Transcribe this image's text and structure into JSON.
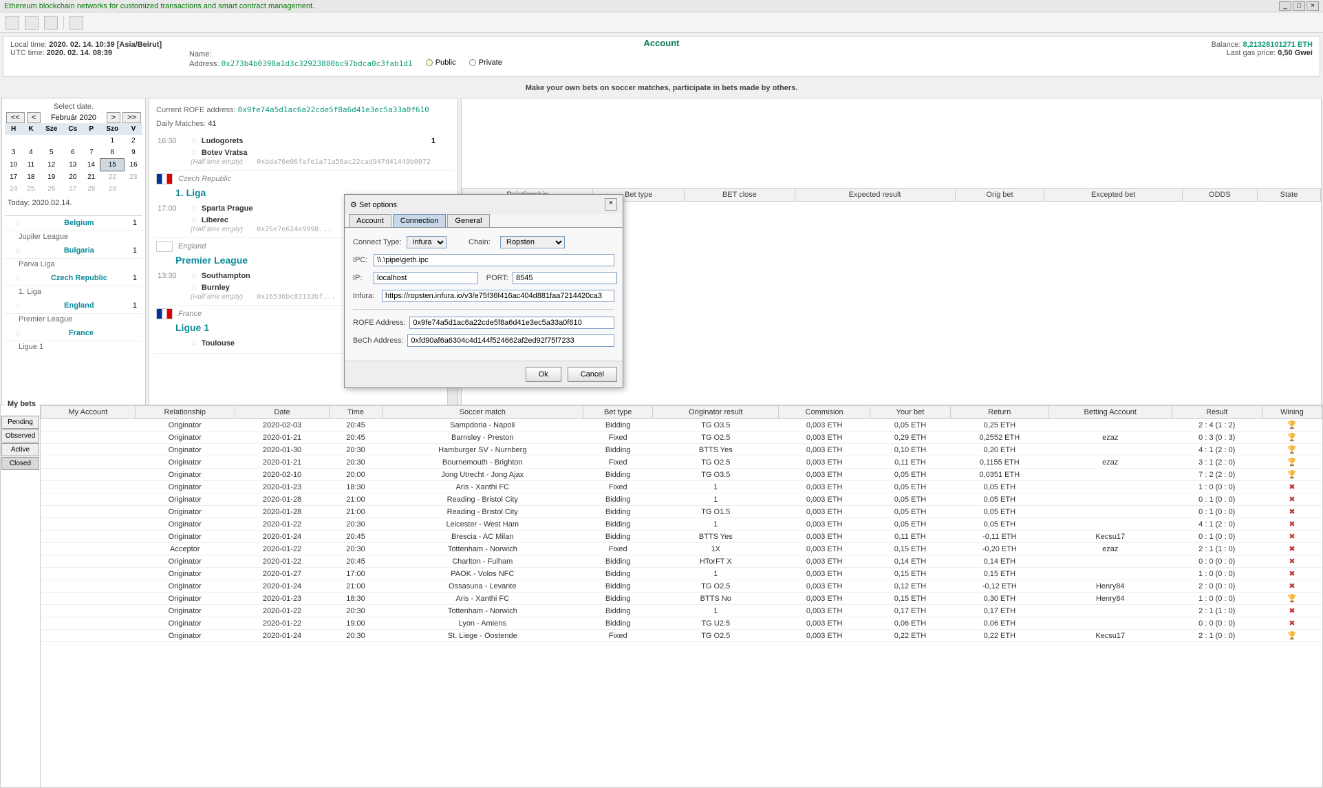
{
  "app": {
    "title": "Ethereum blockchain networks for customized transactions and smart contract management."
  },
  "time": {
    "local_label": "Local time:",
    "local_value": "2020. 02. 14. 10:39 [Asia/Beirut]",
    "utc_label": "UTC time:",
    "utc_value": "2020. 02. 14. 08:39"
  },
  "account": {
    "title": "Account",
    "name_label": "Name:",
    "address_label": "Address:",
    "address_value": "0x273b4b0398a1d3c32923880bc97bdca0c3fab1d1",
    "public_label": "Public",
    "private_label": "Private",
    "balance_label": "Balance:",
    "balance_value": "8,21328101271 ETH",
    "gas_label": "Last gas price:",
    "gas_value": "0,50 Gwei"
  },
  "subtitle": "Make your own bets on soccer matches, participate in bets made by others.",
  "calendar": {
    "select_label": "Select date.",
    "month": "Február",
    "year": "2020",
    "days": [
      "H",
      "K",
      "Sze",
      "Cs",
      "P",
      "Szo",
      "V"
    ],
    "today_label": "Today:",
    "today_value": "2020.02.14."
  },
  "countries": [
    {
      "name": "Belgium",
      "count": "1",
      "league": "Jupiler League"
    },
    {
      "name": "Bulgaria",
      "count": "1",
      "league": "Parva Liga"
    },
    {
      "name": "Czech Republic",
      "count": "1",
      "league": "1. Liga"
    },
    {
      "name": "England",
      "count": "1",
      "league": "Premier League"
    },
    {
      "name": "France",
      "count": "",
      "league": "Ligue 1"
    }
  ],
  "matches": {
    "rofe_label": "Current ROFE address:",
    "rofe_value": "0x9fe74a5d1ac6a22cde5f8a6d41e3ec5a33a0f610",
    "daily_label": "Daily Matches:",
    "daily_value": "41",
    "groups": [
      {
        "time": "16:30",
        "team1": "Ludogorets",
        "team2": "Botev Vratsa",
        "score": "1",
        "halftime": "(Half time empty)",
        "hash": "0xbda76e06fafe1a71a56ac22cad947d41449b0072"
      },
      {
        "country": "Czech Republic",
        "flag": "cz",
        "league": "1. Liga",
        "time": "17:00",
        "team1": "Sparta Prague",
        "team2": "Liberec",
        "halftime": "(Half time empty)",
        "hash": "0x25e7e624e9998..."
      },
      {
        "country": "England",
        "flag": "en",
        "league": "Premier League",
        "time": "13:30",
        "team1": "Southampton",
        "team2": "Burnley",
        "halftime": "(Half time empty)",
        "hash": "0x16536bc83133bf..."
      },
      {
        "country": "France",
        "flag": "fr",
        "league": "Ligue 1",
        "time": "",
        "team1": "Toulouse",
        "team2": "",
        "halftime": "",
        "hash": ""
      }
    ]
  },
  "bet_headers": [
    "Relationship",
    "Bet type",
    "BET close",
    "Expected result",
    "Orig bet",
    "Excepted bet",
    "ODDS",
    "State"
  ],
  "modal": {
    "title": "Set options",
    "tabs": [
      "Account",
      "Connection",
      "General"
    ],
    "connect_type_label": "Connect Type:",
    "connect_type_value": "infura",
    "chain_label": "Chain:",
    "chain_value": "Ropsten",
    "ipc_label": "IPC:",
    "ipc_value": "\\\\.\\pipe\\geth.ipc",
    "ip_label": "IP:",
    "ip_value": "localhost",
    "port_label": "PORT:",
    "port_value": "8545",
    "infura_label": "Infura:",
    "infura_value": "https://ropsten.infura.io/v3/e75f36f416ac404d881faa7214420ca3",
    "rofe_label": "ROFE Address:",
    "rofe_value": "0x9fe74a5d1ac6a22cde5f8a6d41e3ec5a33a0f610",
    "bech_label": "BeCh Address:",
    "bech_value": "0xfd90af6a6304c4d144f524662af2ed92f75f7233",
    "ok": "Ok",
    "cancel": "Cancel"
  },
  "mybets": {
    "title": "My bets",
    "status_tabs": [
      "Pending",
      "Observed",
      "Active",
      "Closed"
    ],
    "headers": [
      "My Account",
      "Relationship",
      "Date",
      "Time",
      "Soccer match",
      "Bet type",
      "Originator result",
      "Commision",
      "Your bet",
      "Return",
      "Betting Account",
      "Result",
      "Wining"
    ],
    "rows": [
      {
        "rel": "Originator",
        "date": "2020-02-03",
        "time": "20:45",
        "match": "Sampdoria - Napoli",
        "btype": "Bidding",
        "ores": "TG O3.5",
        "com": "0,003 ETH",
        "ybet": "0,05 ETH",
        "ret": "0,25 ETH",
        "retc": "pos",
        "bacc": "",
        "result": "2 : 4 (1 : 2)",
        "win": "y"
      },
      {
        "rel": "Originator",
        "date": "2020-01-21",
        "time": "20:45",
        "match": "Barnsley - Preston",
        "btype": "Fixed",
        "ores": "TG O2.5",
        "com": "0,003 ETH",
        "ybet": "0,29 ETH",
        "ret": "0,2552 ETH",
        "retc": "pos",
        "bacc": "ezaz",
        "result": "0 : 3 (0 : 3)",
        "win": "y"
      },
      {
        "rel": "Originator",
        "date": "2020-01-30",
        "time": "20:30",
        "match": "Hamburger SV - Nurnberg",
        "btype": "Bidding",
        "ores": "BTTS Yes",
        "com": "0,003 ETH",
        "ybet": "0,10 ETH",
        "ret": "0,20 ETH",
        "retc": "pos",
        "bacc": "",
        "result": "4 : 1 (2 : 0)",
        "win": "y"
      },
      {
        "rel": "Originator",
        "date": "2020-01-21",
        "time": "20:30",
        "match": "Bournemouth - Brighton",
        "btype": "Fixed",
        "ores": "TG O2.5",
        "com": "0,003 ETH",
        "ybet": "0,11 ETH",
        "ret": "0,1155 ETH",
        "retc": "pos",
        "bacc": "ezaz",
        "result": "3 : 1 (2 : 0)",
        "win": "y"
      },
      {
        "rel": "Originator",
        "date": "2020-02-10",
        "time": "20:00",
        "match": "Jong Utrecht - Jong Ajax",
        "btype": "Bidding",
        "ores": "TG O3.5",
        "com": "0,003 ETH",
        "ybet": "0,05 ETH",
        "ret": "0,0351 ETH",
        "retc": "pos",
        "bacc": "",
        "result": "7 : 2 (2 : 0)",
        "win": "y"
      },
      {
        "rel": "Originator",
        "date": "2020-01-23",
        "time": "18:30",
        "match": "Aris - Xanthi FC",
        "btype": "Fixed",
        "ores": "1",
        "com": "0,003 ETH",
        "ybet": "0,05 ETH",
        "ret": "0,05 ETH",
        "retc": "gray",
        "bacc": "",
        "result": "1 : 0 (0 : 0)",
        "win": "n"
      },
      {
        "rel": "Originator",
        "date": "2020-01-28",
        "time": "21:00",
        "match": "Reading - Bristol City",
        "btype": "Bidding",
        "ores": "1",
        "com": "0,003 ETH",
        "ybet": "0,05 ETH",
        "ret": "0,05 ETH",
        "retc": "gray",
        "bacc": "",
        "result": "0 : 1 (0 : 0)",
        "win": "n"
      },
      {
        "rel": "Originator",
        "date": "2020-01-28",
        "time": "21:00",
        "match": "Reading - Bristol City",
        "btype": "Bidding",
        "ores": "TG O1.5",
        "com": "0,003 ETH",
        "ybet": "0,05 ETH",
        "ret": "0,05 ETH",
        "retc": "gray",
        "bacc": "",
        "result": "0 : 1 (0 : 0)",
        "win": "n"
      },
      {
        "rel": "Originator",
        "date": "2020-01-22",
        "time": "20:30",
        "match": "Leicester - West Ham",
        "btype": "Bidding",
        "ores": "1",
        "com": "0,003 ETH",
        "ybet": "0,05 ETH",
        "ret": "0,05 ETH",
        "retc": "gray",
        "bacc": "",
        "result": "4 : 1 (2 : 0)",
        "win": "n"
      },
      {
        "rel": "Originator",
        "date": "2020-01-24",
        "time": "20:45",
        "match": "Brescia - AC Milan",
        "btype": "Bidding",
        "ores": "BTTS Yes",
        "com": "0,003 ETH",
        "ybet": "0,11 ETH",
        "ret": "-0,11 ETH",
        "retc": "neg",
        "bacc": "Kecsu17",
        "result": "0 : 1 (0 : 0)",
        "win": "n"
      },
      {
        "rel": "Acceptor",
        "date": "2020-01-22",
        "time": "20:30",
        "match": "Tottenham - Norwich",
        "btype": "Fixed",
        "ores": "1X",
        "com": "0,003 ETH",
        "ybet": "0,15 ETH",
        "ret": "-0,20 ETH",
        "retc": "neg",
        "bacc": "ezaz",
        "result": "2 : 1 (1 : 0)",
        "win": "n"
      },
      {
        "rel": "Originator",
        "date": "2020-01-22",
        "time": "20:45",
        "match": "Charlton - Fulham",
        "btype": "Bidding",
        "ores": "HTorFT X",
        "com": "0,003 ETH",
        "ybet": "0,14 ETH",
        "ret": "0,14 ETH",
        "retc": "gray",
        "bacc": "",
        "result": "0 : 0 (0 : 0)",
        "win": "n"
      },
      {
        "rel": "Originator",
        "date": "2020-01-27",
        "time": "17:00",
        "match": "PAOK - Volos NFC",
        "btype": "Bidding",
        "ores": "1",
        "com": "0,003 ETH",
        "ybet": "0,15 ETH",
        "ret": "0,15 ETH",
        "retc": "gray",
        "bacc": "",
        "result": "1 : 0 (0 : 0)",
        "win": "n"
      },
      {
        "rel": "Originator",
        "date": "2020-01-24",
        "time": "21:00",
        "match": "Ossasuna - Levante",
        "btype": "Bidding",
        "ores": "TG O2.5",
        "com": "0,003 ETH",
        "ybet": "0,12 ETH",
        "ret": "-0,12 ETH",
        "retc": "neg",
        "bacc": "Henry84",
        "result": "2 : 0 (0 : 0)",
        "win": "n"
      },
      {
        "rel": "Originator",
        "date": "2020-01-23",
        "time": "18:30",
        "match": "Aris - Xanthi FC",
        "btype": "Bidding",
        "ores": "BTTS No",
        "com": "0,003 ETH",
        "ybet": "0,15 ETH",
        "ret": "0,30 ETH",
        "retc": "pos",
        "bacc": "Henry84",
        "result": "1 : 0 (0 : 0)",
        "win": "y"
      },
      {
        "rel": "Originator",
        "date": "2020-01-22",
        "time": "20:30",
        "match": "Tottenham - Norwich",
        "btype": "Bidding",
        "ores": "1",
        "com": "0,003 ETH",
        "ybet": "0,17 ETH",
        "ret": "0,17 ETH",
        "retc": "gray",
        "bacc": "",
        "result": "2 : 1 (1 : 0)",
        "win": "n"
      },
      {
        "rel": "Originator",
        "date": "2020-01-22",
        "time": "19:00",
        "match": "Lyon - Amiens",
        "btype": "Bidding",
        "ores": "TG U2.5",
        "com": "0,003 ETH",
        "ybet": "0,06 ETH",
        "ret": "0,06 ETH",
        "retc": "gray",
        "bacc": "",
        "result": "0 : 0 (0 : 0)",
        "win": "n"
      },
      {
        "rel": "Originator",
        "date": "2020-01-24",
        "time": "20:30",
        "match": "St. Liege - Oostende",
        "btype": "Fixed",
        "ores": "TG O2.5",
        "com": "0,003 ETH",
        "ybet": "0,22 ETH",
        "ret": "0,22 ETH",
        "retc": "pos",
        "bacc": "Kecsu17",
        "result": "2 : 1 (0 : 0)",
        "win": "y"
      }
    ]
  }
}
